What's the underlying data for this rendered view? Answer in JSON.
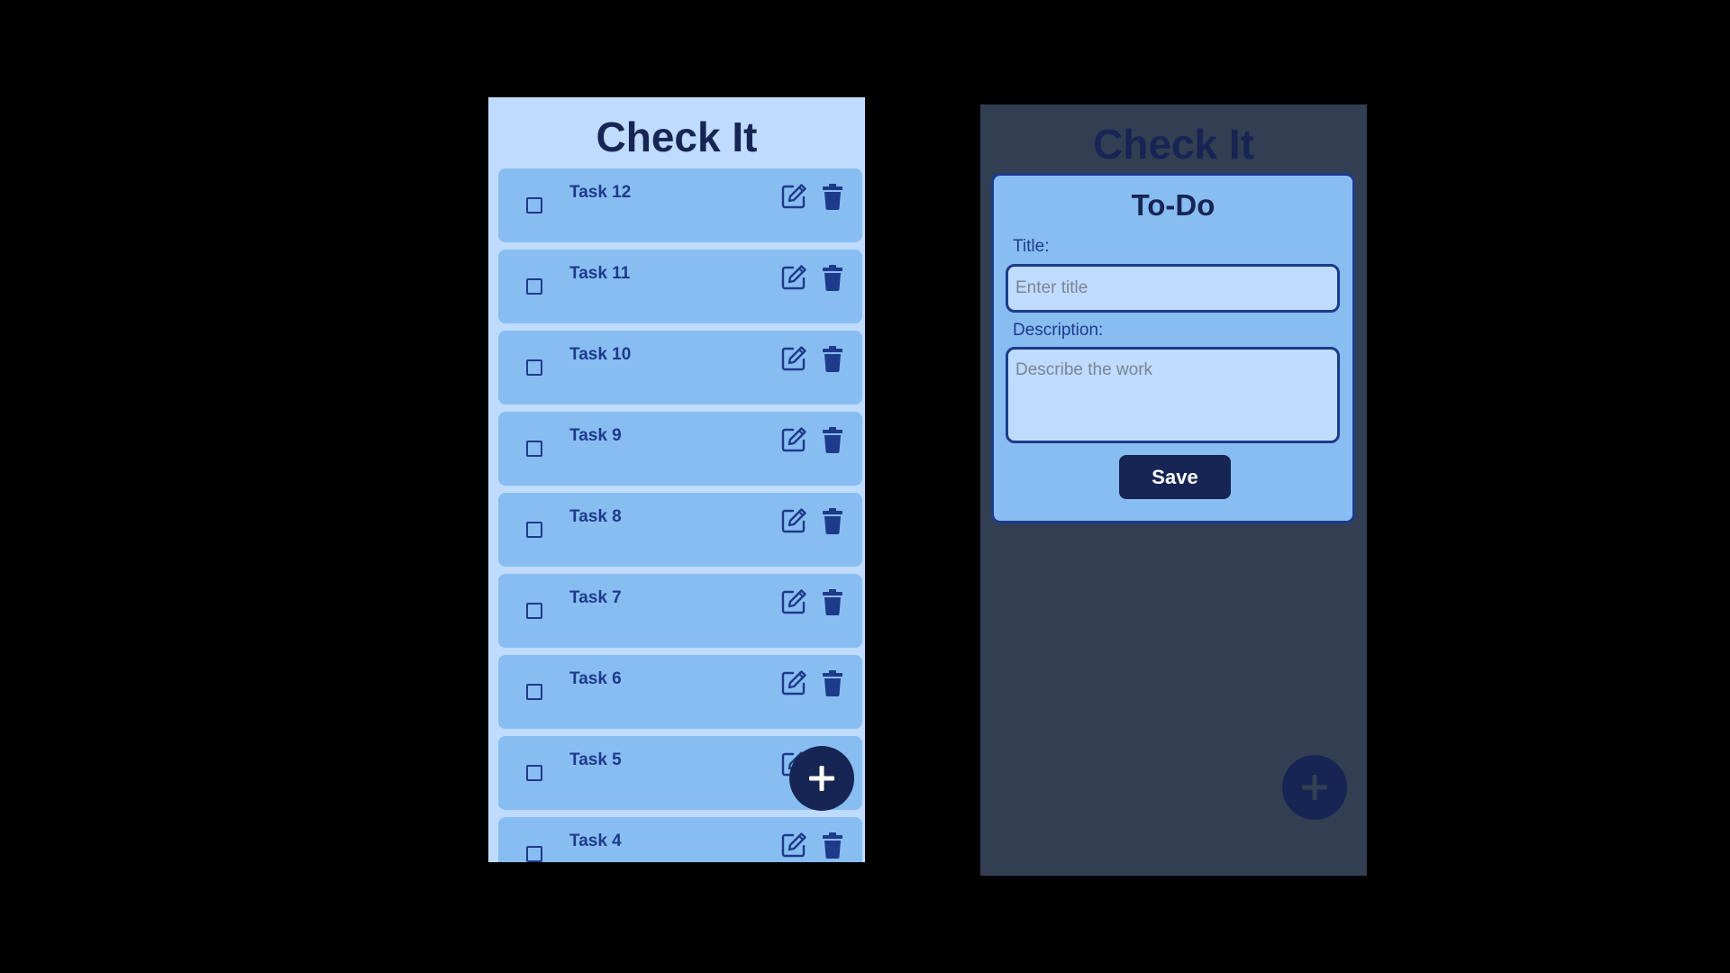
{
  "colors": {
    "background": "#000000",
    "list_background": "#BFDBFE",
    "card_background": "#88BDF2",
    "primary_dark": "#172554",
    "text_dark": "#1E3A8A",
    "overlay_background": "#323F52"
  },
  "list_screen": {
    "app_title": "Check It",
    "tasks": [
      {
        "title": "Task 12",
        "checked": false
      },
      {
        "title": "Task 11",
        "checked": false
      },
      {
        "title": "Task 10",
        "checked": false
      },
      {
        "title": "Task 9",
        "checked": false
      },
      {
        "title": "Task 8",
        "checked": false
      },
      {
        "title": "Task 7",
        "checked": false
      },
      {
        "title": "Task 6",
        "checked": false
      },
      {
        "title": "Task 5",
        "checked": false
      },
      {
        "title": "Task 4",
        "checked": false
      }
    ],
    "icons": {
      "checkbox": "checkbox-icon",
      "edit": "edit-icon",
      "delete": "trash-icon",
      "add": "plus-icon"
    }
  },
  "modal_screen": {
    "app_title": "Check It",
    "modal": {
      "title": "To-Do",
      "title_label": "Title:",
      "title_placeholder": "Enter title",
      "title_value": "",
      "description_label": "Description:",
      "description_placeholder": "Describe the work",
      "description_value": "",
      "save_label": "Save"
    },
    "icons": {
      "add": "plus-icon"
    }
  }
}
